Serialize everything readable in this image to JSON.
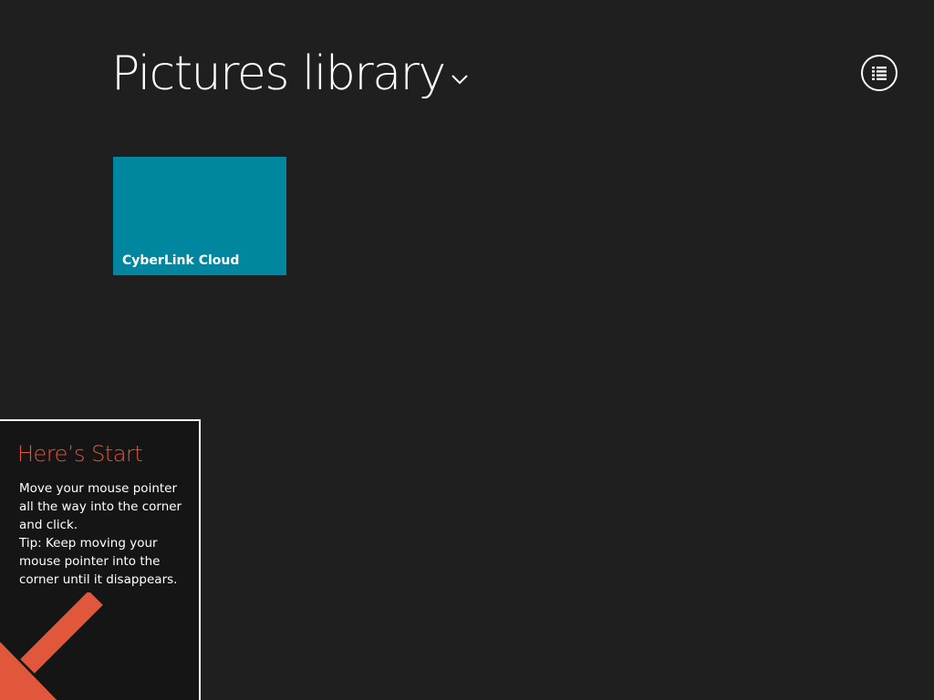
{
  "header": {
    "title": "Pictures library",
    "dropdown_icon": "chevron-down-icon"
  },
  "toolbar": {
    "view_icon": "list-view-icon"
  },
  "tiles": [
    {
      "label": "CyberLink Cloud",
      "color": "#00869e"
    }
  ],
  "start_tip": {
    "title": "Here’s Start",
    "lines": [
      "Move your mouse pointer",
      "all the way into the corner",
      "and click.",
      "Tip: Keep moving your",
      "mouse pointer into the",
      "corner until it disappears."
    ],
    "arrow_icon": "arrow-down-left-icon",
    "accent_color": "#e1573c"
  },
  "colors": {
    "background": "#1f1f1f",
    "tip_background": "#151515"
  }
}
